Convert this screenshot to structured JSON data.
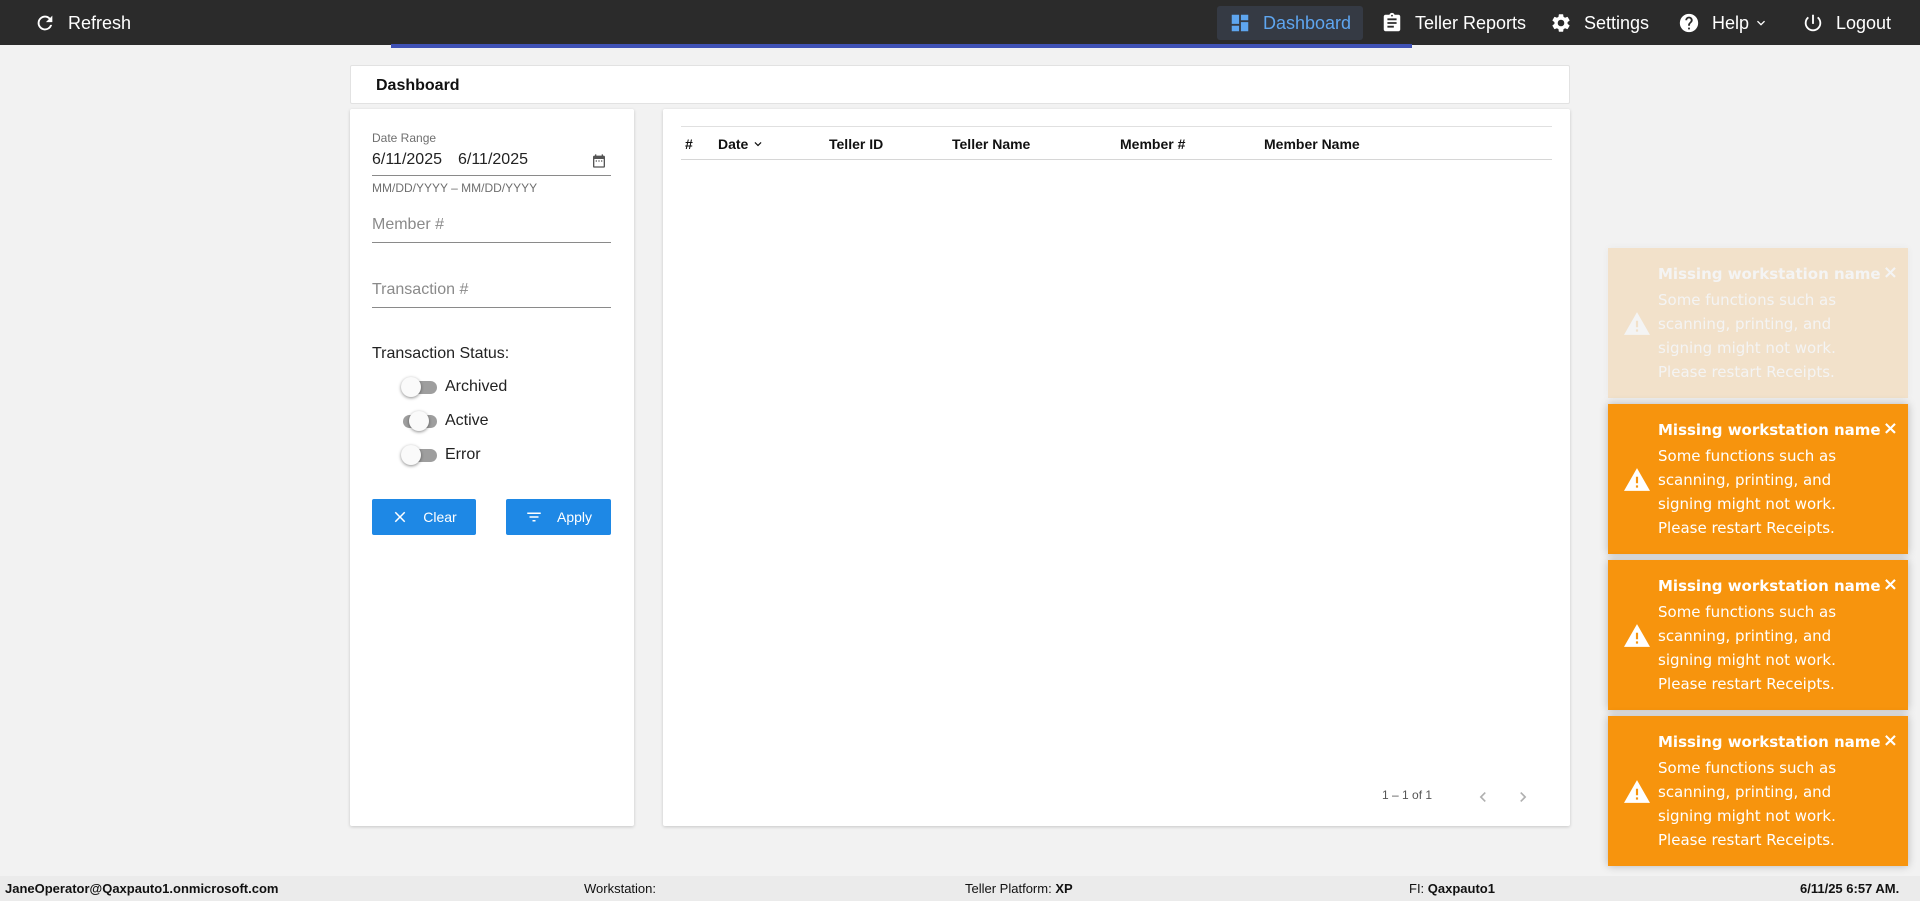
{
  "topbar": {
    "refresh_label": "Refresh",
    "nav": {
      "dashboard": "Dashboard",
      "teller_reports": "Teller Reports",
      "settings": "Settings",
      "help": "Help",
      "logout": "Logout"
    },
    "active_item": "Dashboard",
    "accent_color": "#5ea5ef",
    "accent_line_color": "#3f51b5"
  },
  "page": {
    "title": "Dashboard"
  },
  "filters": {
    "date_range_label": "Date Range",
    "date_start": "6/11/2025",
    "date_end": "6/11/2025",
    "date_hint": "MM/DD/YYYY – MM/DD/YYYY",
    "member_placeholder": "Member #",
    "transaction_placeholder": "Transaction #",
    "status_title": "Transaction Status:",
    "toggles": [
      {
        "label": "Archived",
        "on": false
      },
      {
        "label": "Active",
        "on": false
      },
      {
        "label": "Error",
        "on": false
      }
    ],
    "clear_label": "Clear",
    "apply_label": "Apply",
    "button_color": "#1e88e5"
  },
  "table": {
    "columns": [
      "#",
      "Date",
      "Teller ID",
      "Teller Name",
      "Member #",
      "Member Name"
    ],
    "rows": [],
    "sort_column": "Date",
    "pagination": "1 – 1 of 1"
  },
  "toasts": [
    {
      "title": "Missing workstation name",
      "message": "Some functions such as scanning, printing, and signing might not work. Please restart Receipts.",
      "close": "×",
      "faded": true
    },
    {
      "title": "Missing workstation name",
      "message": "Some functions such as scanning, printing, and signing might not work. Please restart Receipts.",
      "close": "×",
      "faded": false
    },
    {
      "title": "Missing workstation name",
      "message": "Some functions such as scanning, printing, and signing might not work. Please restart Receipts.",
      "close": "×",
      "faded": false
    },
    {
      "title": "Missing workstation name",
      "message": "Some functions such as scanning, printing, and signing might not work. Please restart Receipts.",
      "close": "×",
      "faded": false
    }
  ],
  "toast_color": "#f7940d",
  "footer": {
    "user": "JaneOperator@Qaxpauto1.onmicrosoft.com",
    "workstation_label": "Workstation:",
    "workstation_value": "",
    "platform_label": "Teller Platform:",
    "platform_value": "XP",
    "fi_label": "FI:",
    "fi_value": "Qaxpauto1",
    "timestamp": "6/11/25 6:57 AM."
  }
}
